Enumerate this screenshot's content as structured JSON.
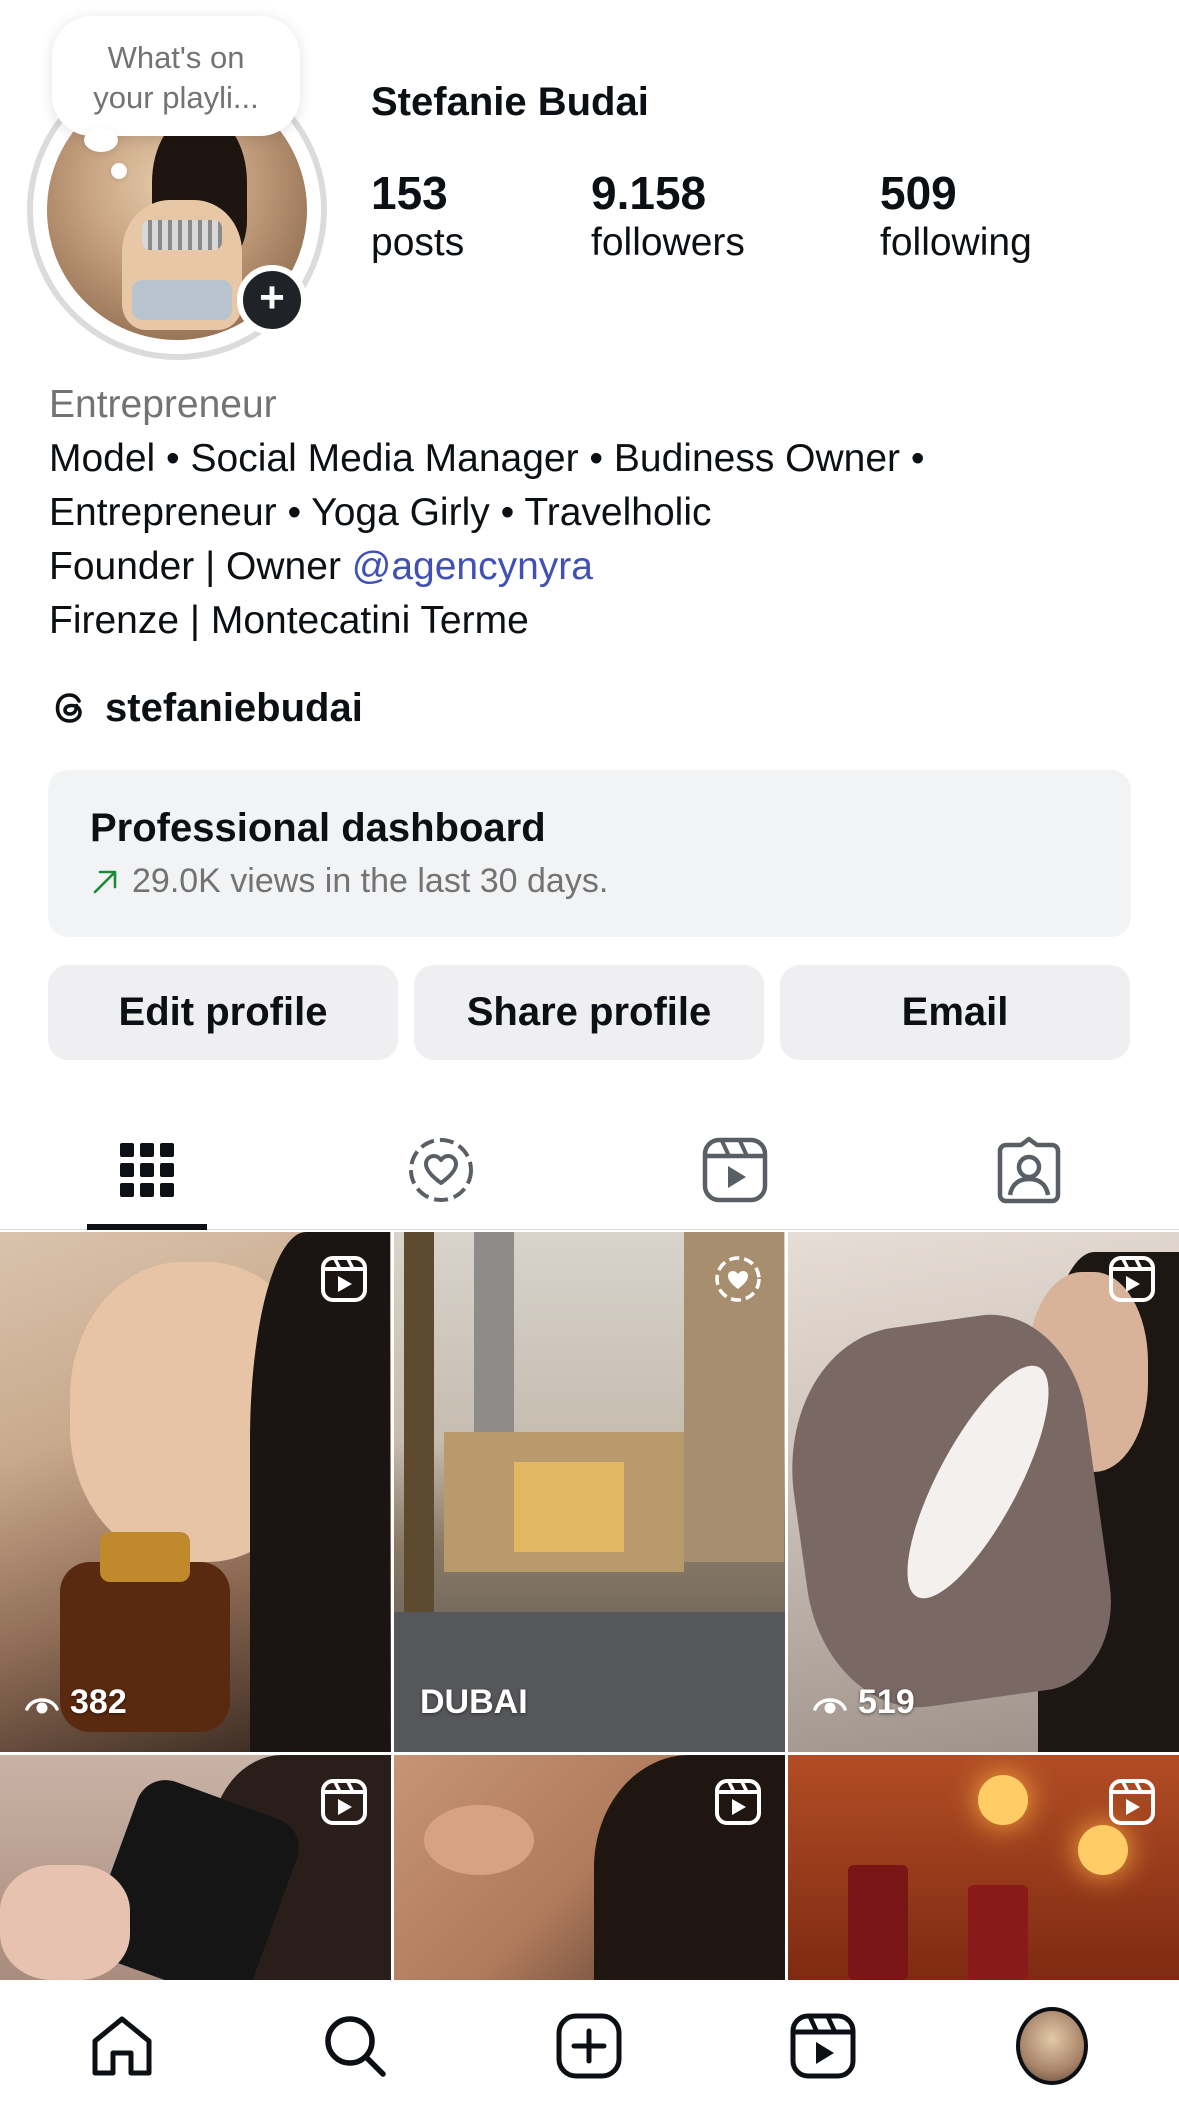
{
  "profile": {
    "name": "Stefanie Budai",
    "note_bubble": "What's on your playli...",
    "stats": [
      {
        "value": "153",
        "label": "posts"
      },
      {
        "value": "9.158",
        "label": "followers"
      },
      {
        "value": "509",
        "label": "following"
      }
    ]
  },
  "bio": {
    "category": "Entrepreneur",
    "line1": "Model • Social Media Manager • Budiness Owner •",
    "line2": "Entrepreneur • Yoga Girly • Travelholic",
    "line3_prefix": "Founder | Owner ",
    "line3_mention": "@agencynyra",
    "line4": "Firenze | Montecatini Terme"
  },
  "threads": {
    "handle": "stefaniebudai",
    "icon": "threads-icon"
  },
  "dashboard": {
    "title": "Professional dashboard",
    "subtitle": "29.0K views in the last 30 days.",
    "trend_color": "#1d8a3a"
  },
  "buttons": {
    "edit": "Edit profile",
    "share": "Share profile",
    "email": "Email"
  },
  "tabs": [
    {
      "icon": "grid-icon",
      "active": true
    },
    {
      "icon": "highlights-icon",
      "active": false
    },
    {
      "icon": "reels-icon",
      "active": false
    },
    {
      "icon": "tagged-icon",
      "active": false
    }
  ],
  "posts": [
    {
      "type": "reel",
      "views": "382"
    },
    {
      "type": "highlight",
      "label": "DUBAI"
    },
    {
      "type": "reel",
      "views": "519"
    },
    {
      "type": "reel"
    },
    {
      "type": "reel"
    },
    {
      "type": "reel"
    }
  ],
  "nav": [
    "home-icon",
    "search-icon",
    "create-icon",
    "reels-icon",
    "profile-avatar"
  ],
  "colors": {
    "text": "#0c1014",
    "secondary": "#737373",
    "link": "#4150b5",
    "button_bg": "#efeff1"
  }
}
